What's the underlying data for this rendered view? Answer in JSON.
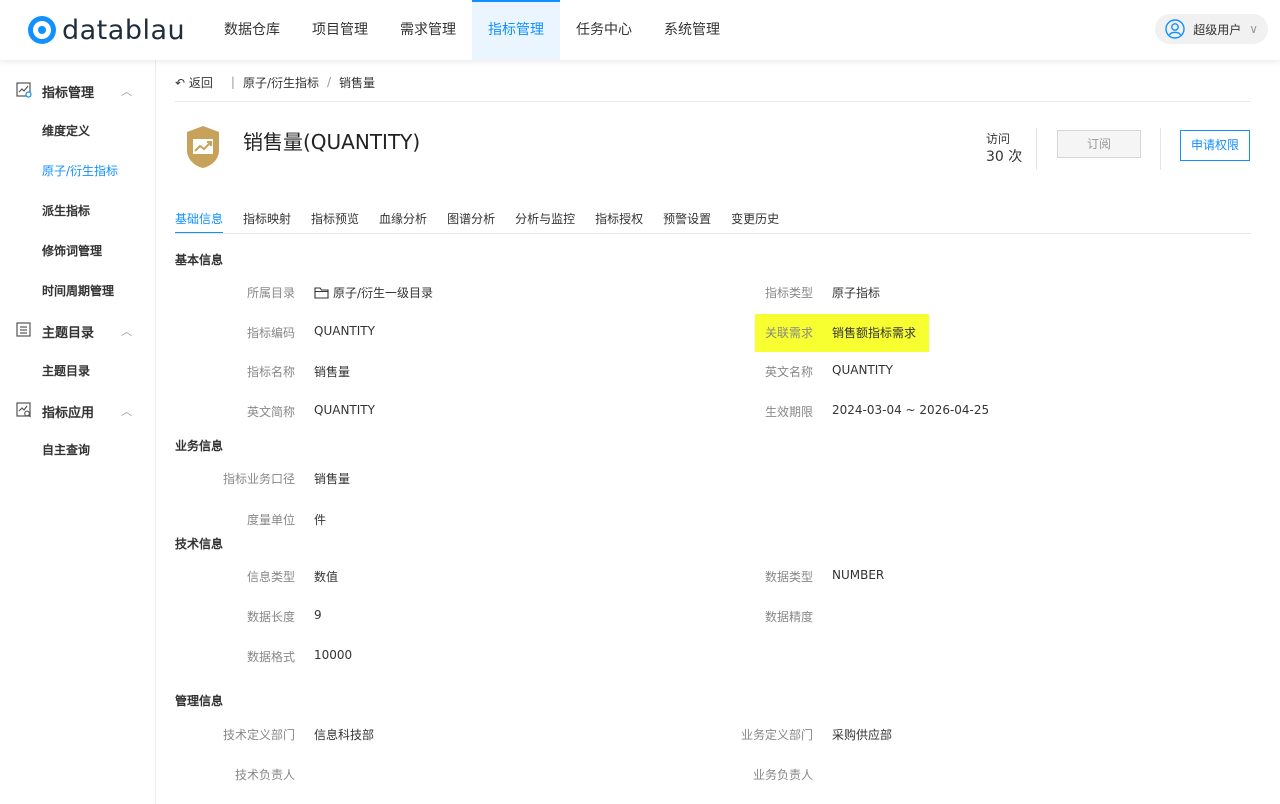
{
  "brand": {
    "name": "datablau"
  },
  "nav": {
    "items": [
      "数据仓库",
      "项目管理",
      "需求管理",
      "指标管理",
      "任务中心",
      "系统管理"
    ],
    "active_index": 3
  },
  "user": {
    "name": "超级用户"
  },
  "sidebar": {
    "groups": [
      {
        "label": "指标管理",
        "items": [
          "维度定义",
          "原子/衍生指标",
          "派生指标",
          "修饰词管理",
          "时间周期管理"
        ]
      },
      {
        "label": "主题目录",
        "items": [
          "主题目录"
        ]
      },
      {
        "label": "指标应用",
        "items": [
          "自主查询"
        ]
      }
    ],
    "active_item": "原子/衍生指标"
  },
  "breadcrumb": {
    "back": "返回",
    "separator": "|",
    "path": [
      "原子/衍生指标",
      "销售量"
    ],
    "path_sep": "/"
  },
  "header": {
    "title": "销售量(QUANTITY)",
    "visit_label": "访问",
    "visit_count": "30 次",
    "subscribe_label": "订阅",
    "apply_label": "申请权限"
  },
  "tabs": [
    "基础信息",
    "指标映射",
    "指标预览",
    "血缘分析",
    "图谱分析",
    "分析与监控",
    "指标授权",
    "预警设置",
    "变更历史"
  ],
  "basic": {
    "section": "基本信息",
    "catalog_label": "所属目录",
    "catalog_value": "原子/衍生一级目录",
    "type_label": "指标类型",
    "type_value": "原子指标",
    "code_label": "指标编码",
    "code_value": "QUANTITY",
    "req_label": "关联需求",
    "req_value": "销售额指标需求",
    "name_label": "指标名称",
    "name_value": "销售量",
    "en_label": "英文名称",
    "en_value": "QUANTITY",
    "abbr_label": "英文简称",
    "abbr_value": "QUANTITY",
    "period_label": "生效期限",
    "period_value": "2024-03-04 ~ 2026-04-25"
  },
  "business": {
    "section": "业务信息",
    "caliber_label": "指标业务口径",
    "caliber_value": "销售量",
    "unit_label": "度量单位",
    "unit_value": "件"
  },
  "tech": {
    "section": "技术信息",
    "info_type_label": "信息类型",
    "info_type_value": "数值",
    "data_type_label": "数据类型",
    "data_type_value": "NUMBER",
    "length_label": "数据长度",
    "length_value": "9",
    "precision_label": "数据精度",
    "precision_value": "",
    "format_label": "数据格式",
    "format_value": "10000"
  },
  "mgmt": {
    "section": "管理信息",
    "tech_dept_label": "技术定义部门",
    "tech_dept_value": "信息科技部",
    "biz_dept_label": "业务定义部门",
    "biz_dept_value": "采购供应部",
    "tech_owner_label": "技术负责人",
    "biz_owner_label": "业务负责人"
  },
  "colors": {
    "accent": "#1190ff",
    "highlight": "#f8ff30",
    "icon_gold": "#c8a25a"
  }
}
